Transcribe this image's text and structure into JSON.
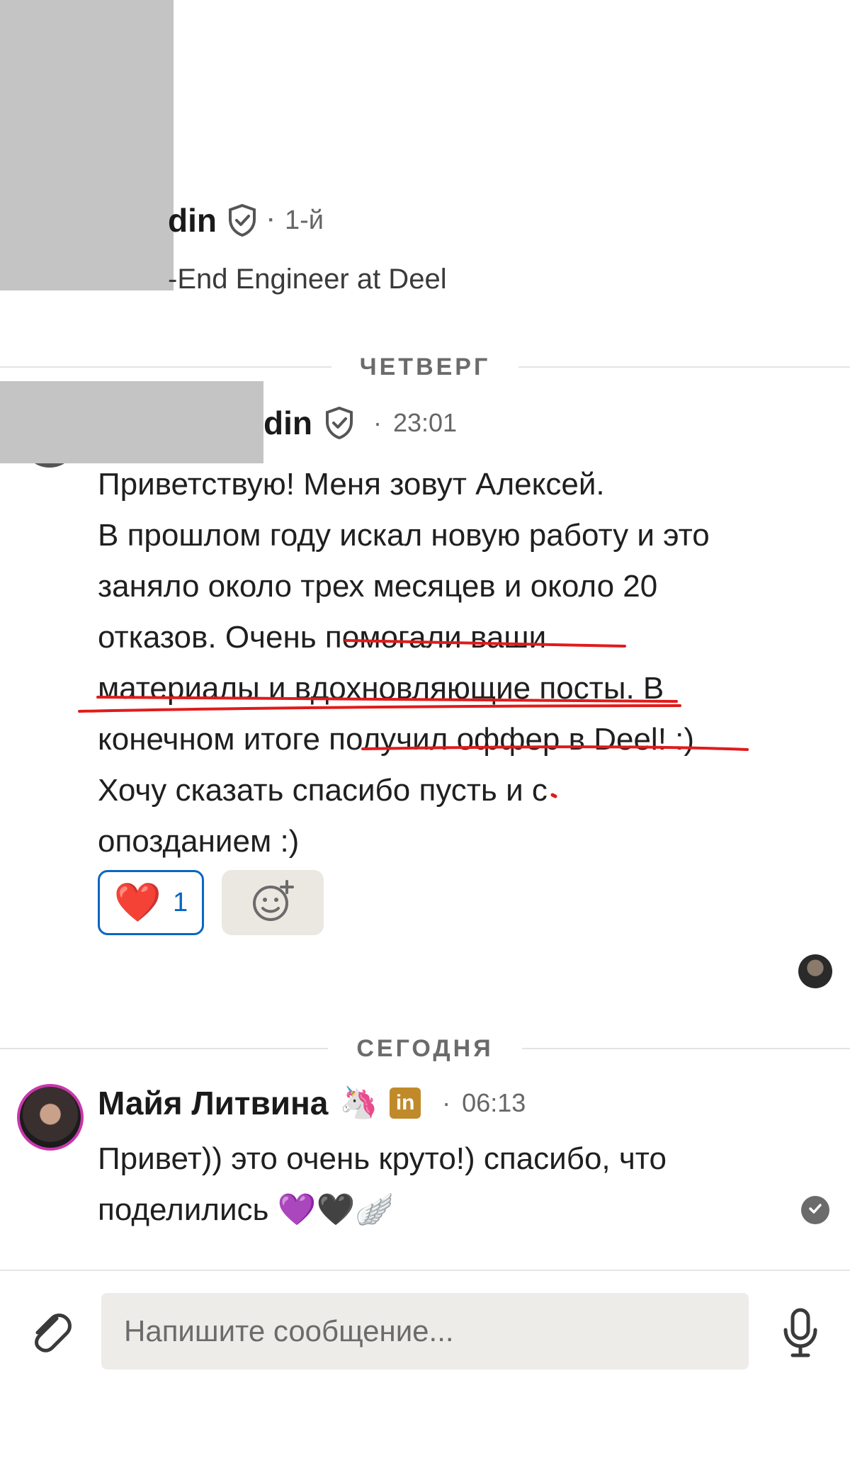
{
  "profile": {
    "name_fragment": "din",
    "degree": "1-й",
    "separator": "·",
    "headline_fragment": "-End Engineer at Deel"
  },
  "separators": {
    "thursday": "ЧЕТВЕРГ",
    "today": "СЕГОДНЯ"
  },
  "message1": {
    "sender_fragment": "din",
    "separator": "·",
    "time": "23:01",
    "text": "Приветствую! Меня зовут Алексей.\nВ прошлом году искал новую работу и это\nзаняло около трех месяцев и около 20\nотказов. Очень помогали ваши\nматериалы и вдохновляющие посты. В\nконечном итоге получил оффер в Deel! :)\nХочу сказать спасибо пусть и с\nопозданием :)",
    "reaction_emoji": "❤️",
    "reaction_count": "1"
  },
  "message2": {
    "sender": "Майя Литвина",
    "sender_emoji": "🦄",
    "badge": "in",
    "separator": "·",
    "time": "06:13",
    "text": "Привет)) это очень круто!) спасибо, что\nподелились 💜🖤🪽"
  },
  "composer": {
    "placeholder": "Напишите сообщение..."
  },
  "colors": {
    "accent": "#0a66c2",
    "annotation_red": "#e01b1b",
    "premium_gold": "#c08a2b",
    "avatar_ring": "#c837ab"
  },
  "icons": [
    "shield-check-icon",
    "heart-icon",
    "add-reaction-icon",
    "paperclip-icon",
    "microphone-icon",
    "check-icon"
  ]
}
